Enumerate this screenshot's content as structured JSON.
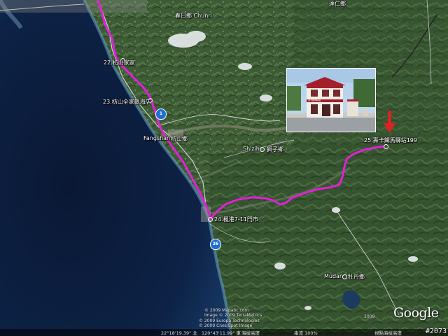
{
  "map": {
    "colors": {
      "ocean": "#0b1b3a",
      "land": "#3a5a34",
      "route": "#e020d8",
      "road": "#c9c9c9",
      "shield": "#1f6fd1"
    },
    "labels": {
      "jiaxin": "22.枋山家家",
      "fangshan_shop": "23.枋山全家觀海店",
      "fangshan_en": "Fangshan",
      "fangshan_zh": "枋山鄉",
      "shizi_en": "Shizih",
      "shizi_zh": "獅子鄉",
      "fenggang": "24.楓港7-11門市",
      "shouka": "25.壽卡鐵馬驛站199",
      "mudan_en": "Mudan",
      "mudan_zh": "牡丹鄉",
      "chunri": "春日鄉 Chunri",
      "top_right": "達仁鄉"
    },
    "shields": {
      "a": "1",
      "b": "26"
    },
    "photo": {
      "caption": "壽卡鐵馬驛站"
    },
    "credits": [
      "© 2009 Mapabc.com",
      "Image © 2009 TerraMetrics",
      "© 2009 Europa Technologies",
      "© 2009 Cnes/Spot Image"
    ],
    "status": {
      "lat": "22°18'19.39\" 北",
      "lon": "120°43'11.99\" 東",
      "elev": "海拔高度",
      "stream": "串流 100%",
      "eye": "視點海拔高度",
      "year": "2009"
    },
    "brand": "Google",
    "frame_id": "#2073"
  }
}
